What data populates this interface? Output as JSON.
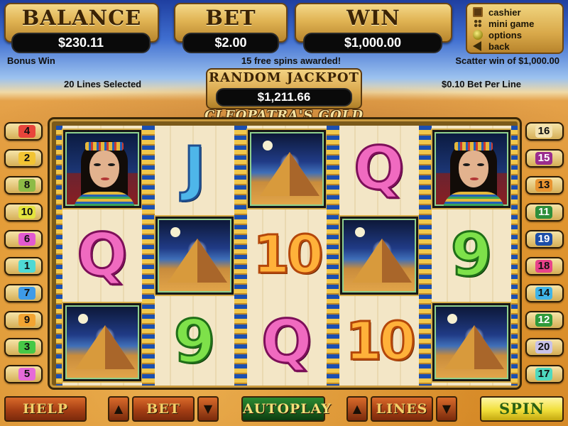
{
  "header": {
    "balance": {
      "title": "BALANCE",
      "value": "$230.11"
    },
    "bet": {
      "title": "BET",
      "value": "$2.00"
    },
    "win": {
      "title": "WIN",
      "value": "$1,000.00"
    }
  },
  "menu": {
    "items": [
      {
        "label": "cashier",
        "icon": "cashier-icon"
      },
      {
        "label": "mini game",
        "icon": "mini-game-icon"
      },
      {
        "label": "options",
        "icon": "options-icon"
      },
      {
        "label": "back",
        "icon": "back-arrow-icon"
      }
    ]
  },
  "status": {
    "bonus": "Bonus Win",
    "free_spins": "15 free spins awarded!",
    "scatter": "Scatter win of $1,000.00",
    "lines_selected": "20 Lines Selected",
    "bet_per_line": "$0.10 Bet Per Line"
  },
  "jackpot": {
    "title": "RANDOM JACKPOT",
    "value": "$1,211.66"
  },
  "game_title": "CLEOPATRA'S GOLD",
  "reels": [
    [
      {
        "symbol": "cleopatra"
      },
      {
        "symbol": "Q"
      },
      {
        "symbol": "pyramid"
      }
    ],
    [
      {
        "symbol": "J"
      },
      {
        "symbol": "pyramid"
      },
      {
        "symbol": "9"
      }
    ],
    [
      {
        "symbol": "pyramid"
      },
      {
        "symbol": "10"
      },
      {
        "symbol": "Q"
      }
    ],
    [
      {
        "symbol": "Q"
      },
      {
        "symbol": "pyramid"
      },
      {
        "symbol": "10"
      }
    ],
    [
      {
        "symbol": "cleopatra"
      },
      {
        "symbol": "9"
      },
      {
        "symbol": "pyramid"
      }
    ]
  ],
  "lines": {
    "left": [
      {
        "num": "4",
        "color": "#e8443a"
      },
      {
        "num": "2",
        "color": "#f2c433"
      },
      {
        "num": "8",
        "color": "#8dbb46"
      },
      {
        "num": "10",
        "color": "#e4e43e"
      },
      {
        "num": "6",
        "color": "#e25ad0"
      },
      {
        "num": "1",
        "color": "#4fd9d4"
      },
      {
        "num": "7",
        "color": "#3e9be8"
      },
      {
        "num": "9",
        "color": "#f2a432"
      },
      {
        "num": "3",
        "color": "#46c846"
      },
      {
        "num": "5",
        "color": "#e56ad8"
      }
    ],
    "right": [
      {
        "num": "16",
        "color": "#f3e2b0"
      },
      {
        "num": "15",
        "color": "#9a2d8e"
      },
      {
        "num": "13",
        "color": "#e89430"
      },
      {
        "num": "11",
        "color": "#2e8e3a"
      },
      {
        "num": "19",
        "color": "#1c4ea8"
      },
      {
        "num": "18",
        "color": "#e8428a"
      },
      {
        "num": "14",
        "color": "#3fb4e8"
      },
      {
        "num": "12",
        "color": "#2e9a3a"
      },
      {
        "num": "20",
        "color": "#c9c2e8"
      },
      {
        "num": "17",
        "color": "#4fd9bf"
      }
    ]
  },
  "controls": {
    "help": "HELP",
    "bet": "BET",
    "autoplay": "AUTOPLAY",
    "lines": "LINES",
    "spin": "SPIN",
    "up_arrow": "▲",
    "down_arrow": "▼"
  }
}
